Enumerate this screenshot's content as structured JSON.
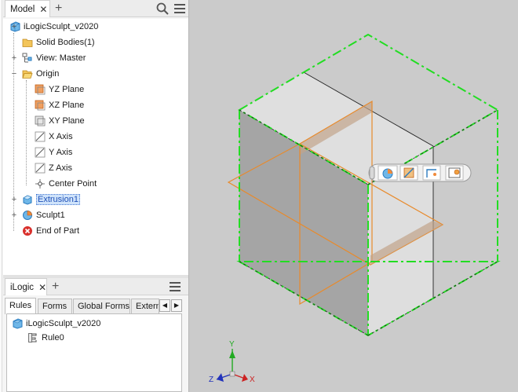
{
  "model_panel": {
    "tab_label": "Model",
    "tree": [
      {
        "id": "root",
        "label": "iLogicSculpt_v2020",
        "icon": "part-cube-icon",
        "expander": ""
      },
      {
        "id": "solid",
        "label": "Solid Bodies(1)",
        "icon": "folder-icon",
        "expander": "+"
      },
      {
        "id": "view",
        "label": "View: Master",
        "icon": "view-rep-icon",
        "expander": "+"
      },
      {
        "id": "origin",
        "label": "Origin",
        "icon": "folder-open-icon",
        "expander": "−"
      },
      {
        "id": "yz",
        "label": "YZ Plane",
        "icon": "plane-icon",
        "expander": ""
      },
      {
        "id": "xz",
        "label": "XZ Plane",
        "icon": "plane-icon",
        "expander": ""
      },
      {
        "id": "xy",
        "label": "XY Plane",
        "icon": "plane-icon",
        "expander": ""
      },
      {
        "id": "xaxis",
        "label": "X Axis",
        "icon": "axis-icon",
        "expander": ""
      },
      {
        "id": "yaxis",
        "label": "Y Axis",
        "icon": "axis-icon",
        "expander": ""
      },
      {
        "id": "zaxis",
        "label": "Z Axis",
        "icon": "axis-icon",
        "expander": ""
      },
      {
        "id": "center",
        "label": "Center Point",
        "icon": "point-icon",
        "expander": ""
      },
      {
        "id": "extrusion",
        "label": "Extrusion1",
        "icon": "extrusion-icon",
        "expander": "+"
      },
      {
        "id": "sculpt",
        "label": "Sculpt1",
        "icon": "sculpt-icon",
        "expander": "+"
      },
      {
        "id": "eop",
        "label": "End of Part",
        "icon": "end-of-part-icon",
        "expander": ""
      }
    ]
  },
  "ilogic_panel": {
    "tab_label": "iLogic",
    "subtabs": [
      "Rules",
      "Forms",
      "Global Forms",
      "External"
    ],
    "active_subtab": "Rules",
    "items": [
      {
        "label": "iLogicSculpt_v2020",
        "icon": "part-cube-icon"
      },
      {
        "label": "Rule0",
        "icon": "rule-icon"
      }
    ]
  },
  "mini_toolbar": [
    "sculpt-add-icon",
    "extents-icon",
    "flip-icon",
    "extents-two-icon"
  ],
  "triad": {
    "x": "X",
    "y": "Y",
    "z": "Z"
  },
  "colors": {
    "preview_green": "#22dd22",
    "plane_orange": "#e88a2b",
    "selection_blue": "#cfe3fa",
    "viewport_bg": "#cbcbcb"
  }
}
